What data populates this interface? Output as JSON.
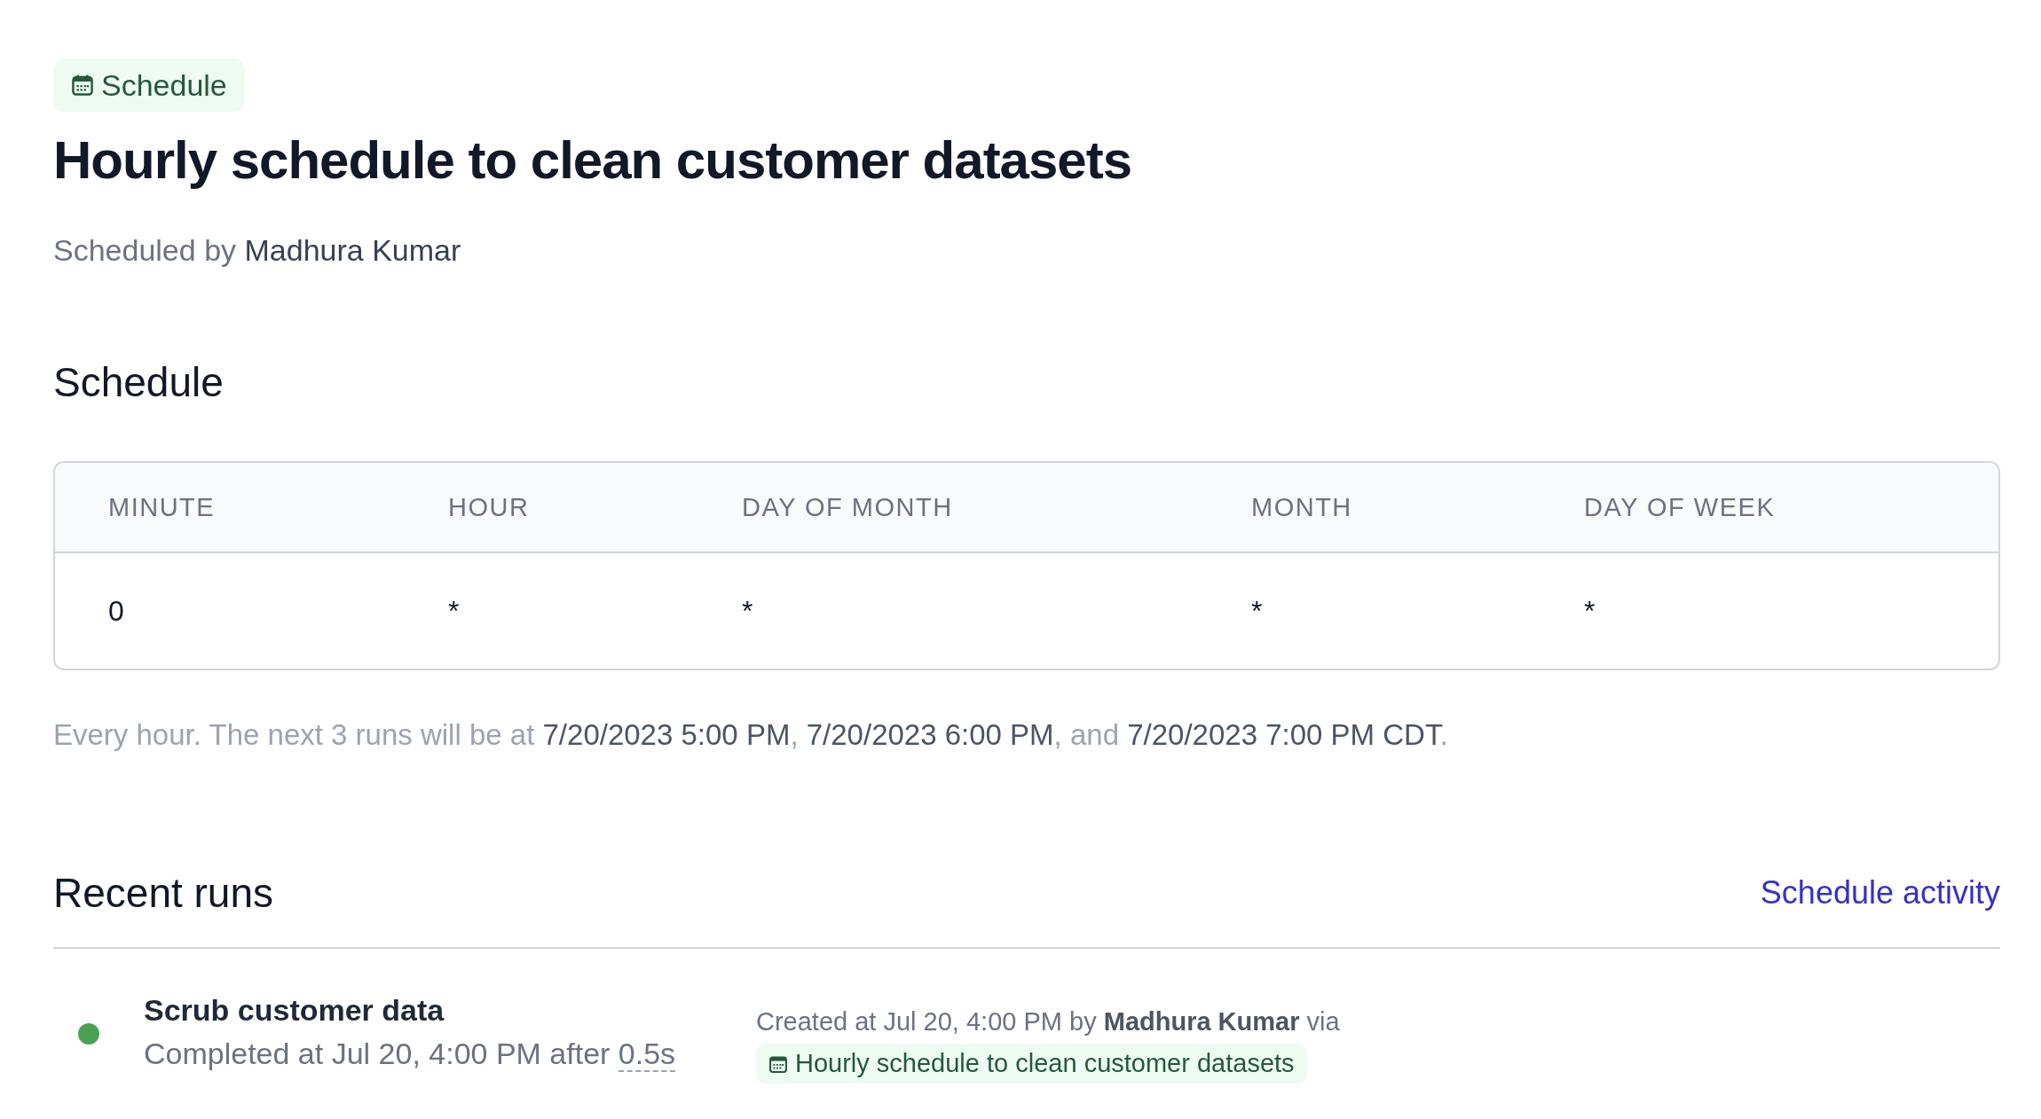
{
  "badge": {
    "label": "Schedule"
  },
  "title": "Hourly schedule to clean customer datasets",
  "byline": "Scheduled by **Madhura Kumar**",
  "schedule_section": {
    "heading": "Schedule",
    "table": {
      "columns": [
        "MINUTE",
        "HOUR",
        "DAY OF MONTH",
        "MONTH",
        "DAY OF WEEK"
      ],
      "rows": [
        [
          "0",
          "*",
          "*",
          "*",
          "*"
        ]
      ]
    },
    "summary": "Every hour. The next 3 runs will be at **7/20/2023 5:00 PM**, **7/20/2023 6:00 PM**, and **7/20/2023 7:00 PM CDT**."
  },
  "recent_runs": {
    "heading": "Recent runs",
    "link": "Schedule activity",
    "runs": [
      {
        "name": "Scrub customer data",
        "color": "#4ca054",
        "completed": "Completed at Jul 20, 4:00 PM after",
        "duration": "0.5s",
        "created": "Created at Jul 20, 4:00 PM by **Madhura Kumar** via",
        "source": "Hourly schedule to clean customer datasets"
      }
    ]
  }
}
